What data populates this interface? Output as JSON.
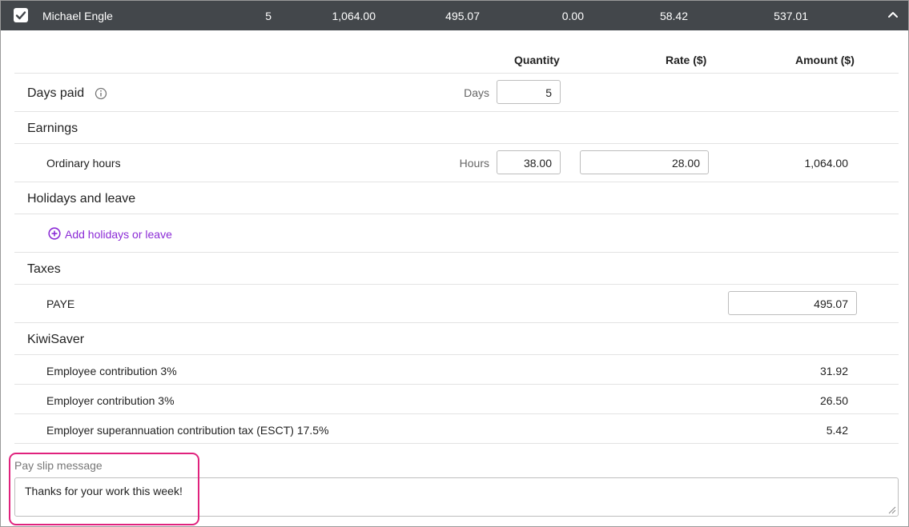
{
  "employee_row": {
    "name": "Michael Engle",
    "days": "5",
    "gross": "1,064.00",
    "tax": "495.07",
    "deductions": "0.00",
    "kiwisaver": "58.42",
    "net": "537.01",
    "checked": true
  },
  "columns": {
    "quantity": "Quantity",
    "rate": "Rate ($)",
    "amount": "Amount ($)"
  },
  "days_paid": {
    "label": "Days paid",
    "unit": "Days",
    "value": "5"
  },
  "earnings": {
    "label": "Earnings",
    "ordinary": {
      "label": "Ordinary hours",
      "unit": "Hours",
      "quantity": "38.00",
      "rate": "28.00",
      "amount": "1,064.00"
    }
  },
  "holidays": {
    "label": "Holidays and leave",
    "add_label": "Add holidays or leave"
  },
  "taxes": {
    "label": "Taxes",
    "paye": {
      "label": "PAYE",
      "amount": "495.07"
    }
  },
  "kiwisaver": {
    "label": "KiwiSaver",
    "items": [
      {
        "label": "Employee contribution 3%",
        "amount": "31.92"
      },
      {
        "label": "Employer contribution 3%",
        "amount": "26.50"
      },
      {
        "label": "Employer superannuation contribution tax (ESCT) 17.5%",
        "amount": "5.42"
      }
    ]
  },
  "pay_slip": {
    "label": "Pay slip message",
    "message": "Thanks for your work this week!"
  },
  "colors": {
    "header_bg": "#43474b",
    "accent": "#8b2bd6",
    "highlight": "#e0227d"
  }
}
